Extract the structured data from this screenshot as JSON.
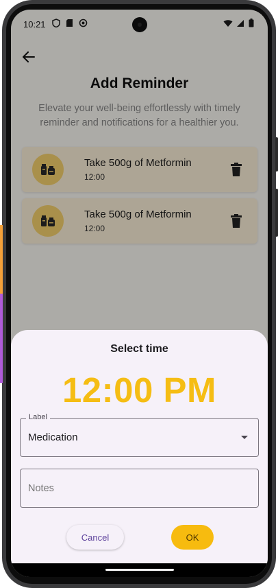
{
  "status_bar": {
    "time": "10:21"
  },
  "header": {
    "title": "Add Reminder",
    "subtitle": "Elevate your well-being effortlessly with timely reminder and notifications for a healthier you."
  },
  "reminders": [
    {
      "name": "Take 500g of Metformin",
      "time": "12:00"
    },
    {
      "name": "Take 500g of Metformin",
      "time": "12:00"
    }
  ],
  "time_sheet": {
    "title": "Select time",
    "selected_time": "12:00 PM",
    "label_field": {
      "label": "Label",
      "value": "Medication"
    },
    "notes_field": {
      "placeholder": "Notes",
      "value": ""
    },
    "cancel_label": "Cancel",
    "ok_label": "OK"
  },
  "colors": {
    "accent": "#f5bd14",
    "card_bg": "#fff3dc",
    "icon_bg": "#fad56f",
    "sheet_bg": "#f6f1f9",
    "cancel_text": "#5b3f9a"
  },
  "icons": [
    "shield-icon",
    "sim-icon",
    "data-saver-icon",
    "wifi-icon",
    "signal-icon",
    "battery-icon",
    "back-arrow-icon",
    "pills-icon",
    "trash-icon",
    "dropdown-caret-icon"
  ]
}
